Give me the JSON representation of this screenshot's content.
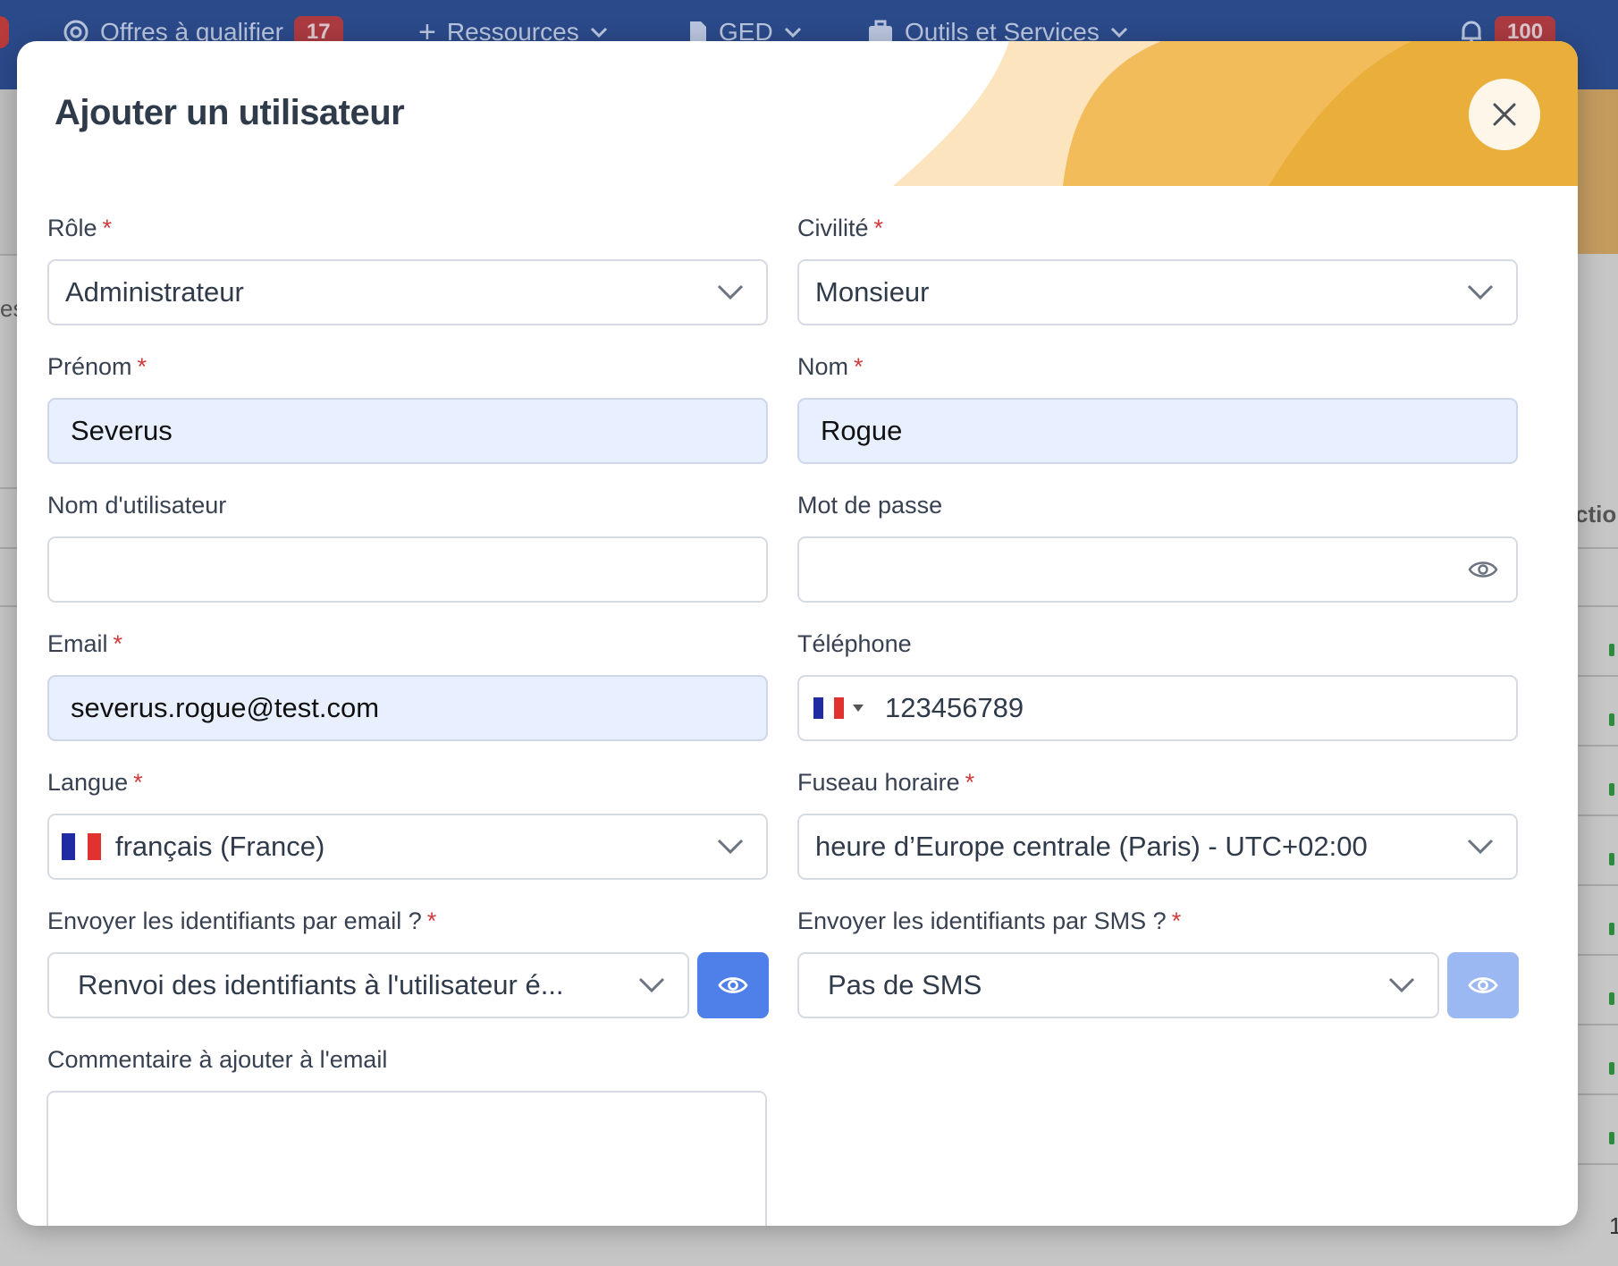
{
  "topnav": {
    "items": [
      {
        "label": "Offres à qualifier",
        "badge": "17"
      },
      {
        "label": "Ressources"
      },
      {
        "label": "GED"
      },
      {
        "label": "Outils et Services"
      }
    ],
    "notifications_badge": "100"
  },
  "background": {
    "left_fragment": "es",
    "right_fragment": "ctio",
    "bottom_right_fragment": "1"
  },
  "modal": {
    "title": "Ajouter un utilisateur",
    "close_label": "×"
  },
  "form": {
    "role": {
      "label": "Rôle",
      "required_mark": "*",
      "value": "Administrateur"
    },
    "civilite": {
      "label": "Civilité",
      "required_mark": "*",
      "value": "Monsieur"
    },
    "prenom": {
      "label": "Prénom",
      "required_mark": "*",
      "value": "Severus"
    },
    "nom": {
      "label": "Nom",
      "required_mark": "*",
      "value": "Rogue"
    },
    "username": {
      "label": "Nom d'utilisateur",
      "value": ""
    },
    "password": {
      "label": "Mot de passe",
      "value": ""
    },
    "email": {
      "label": "Email",
      "required_mark": "*",
      "value": "severus.rogue@test.com"
    },
    "telephone": {
      "label": "Téléphone",
      "value": "123456789",
      "country": "FR"
    },
    "langue": {
      "label": "Langue",
      "required_mark": "*",
      "value": "français (France)"
    },
    "fuseau": {
      "label": "Fuseau horaire",
      "required_mark": "*",
      "value": "heure d’Europe centrale (Paris) - UTC+02:00"
    },
    "send_email": {
      "label": "Envoyer les identifiants par email ?",
      "required_mark": "*",
      "value": "Renvoi des identifiants à l'utilisateur é..."
    },
    "send_sms": {
      "label": "Envoyer les identifiants par SMS ?",
      "required_mark": "*",
      "value": "Pas de SMS"
    },
    "comment": {
      "label": "Commentaire à ajouter à l'email",
      "value": ""
    }
  },
  "colors": {
    "primary": "#4f7fe8",
    "primary_disabled": "#9bb8f3",
    "required": "#d13b3b",
    "filled_bg": "#e8efff",
    "nav_bg": "#2b4a8a"
  }
}
